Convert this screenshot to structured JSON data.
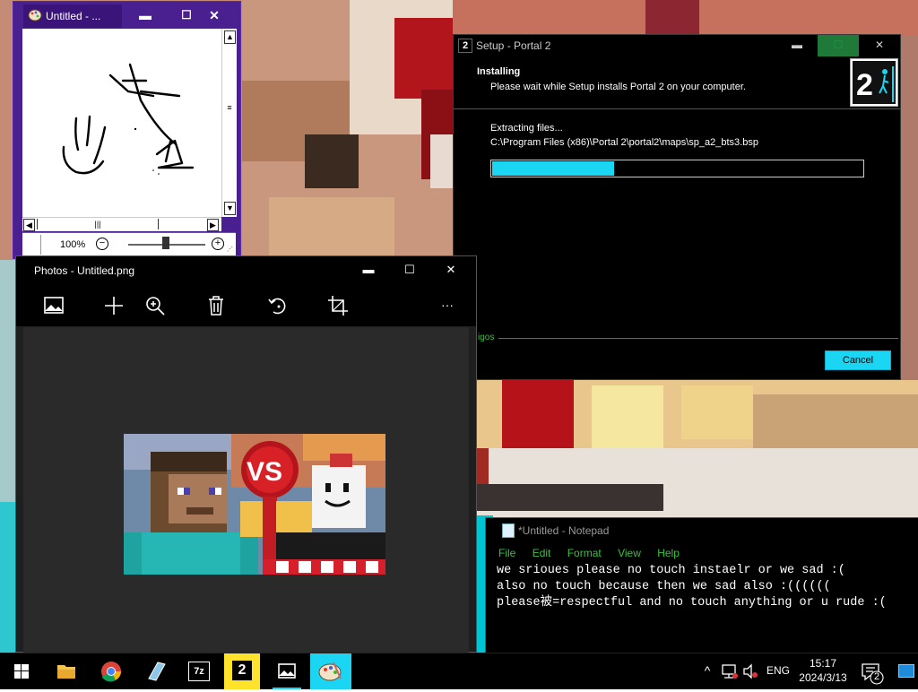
{
  "paint": {
    "title": "Untitled - ...",
    "min": "▬",
    "max": "☐",
    "close": "✕",
    "zoom": "100%"
  },
  "setup": {
    "title": "Setup - Portal 2",
    "header_title": "Installing",
    "header_subtitle": "Please wait while Setup installs Portal 2 on your computer.",
    "status": "Extracting files...",
    "file_path": "C:\\Program Files (x86)\\Portal 2\\portal2\\maps\\sp_a2_bts3.bsp",
    "progress": 0.33,
    "brand": "igos",
    "cancel_label": "Cancel",
    "logo_text": "2"
  },
  "photos": {
    "title": "Photos - Untitled.png",
    "more": "···",
    "image_vs_text": "VS"
  },
  "notepad": {
    "title": "*Untitled - Notepad",
    "menu": [
      "File",
      "Edit",
      "Format",
      "View",
      "Help"
    ],
    "lines": [
      "we srioues please no touch instaelr or we sad :(",
      "also no touch because then we sad also :((((((",
      "please被=respectful and no touch anything or u rude :("
    ]
  },
  "taskbar": {
    "lang": "ENG",
    "time": "15:17",
    "date": "2024/3/13",
    "notifications": "2",
    "sevenzip_label": "7z",
    "portal_label": "2"
  },
  "colors": {
    "accent": "#1ad6f2",
    "paint_frame": "#4a1f8f",
    "green_text": "#39c23e"
  }
}
